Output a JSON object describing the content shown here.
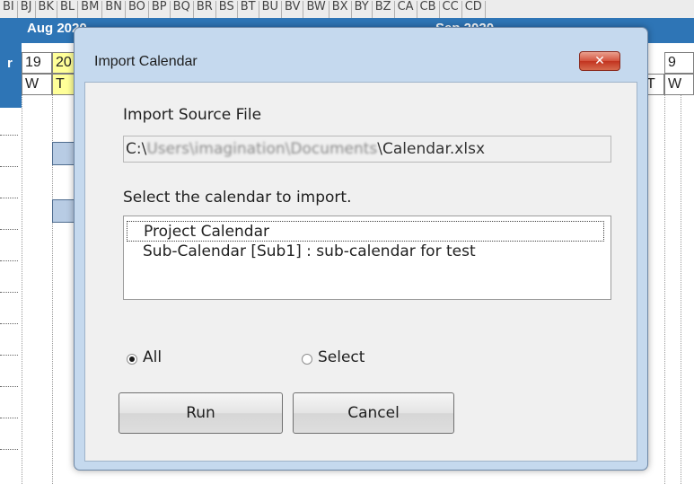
{
  "background": {
    "column_headers": [
      "BI",
      "BJ",
      "BK",
      "BL",
      "BM",
      "BN",
      "BO",
      "BP",
      "BQ",
      "BR",
      "BS",
      "BT",
      "BU",
      "BV",
      "BW",
      "BX",
      "BY",
      "BZ",
      "CA",
      "CB",
      "CC",
      "CD"
    ],
    "month_left": "Aug 2020",
    "month_right": "Sep 2020",
    "left_letter": "r",
    "day_cells": [
      {
        "text": "19",
        "yellow": false
      },
      {
        "text": "20",
        "yellow": true
      },
      {
        "text": "9",
        "yellow": false
      }
    ],
    "weekday_cells": [
      {
        "text": "W",
        "yellow": false
      },
      {
        "text": "T",
        "yellow": true
      },
      {
        "text": "T",
        "yellow": false
      },
      {
        "text": "W",
        "yellow": false
      }
    ]
  },
  "dialog": {
    "title": "Import Calendar",
    "close_glyph": "✕",
    "source_label": "Import Source File",
    "source_path_prefix": "C:\\",
    "source_path_blurred": "Users\\imagination\\Documents",
    "source_path_file": "\\Calendar.xlsx",
    "select_label": "Select the calendar to import.",
    "calendars": [
      {
        "label": "Project Calendar",
        "focused": true
      },
      {
        "label": "Sub-Calendar  [Sub1] : sub-calendar for test",
        "focused": false
      }
    ],
    "radio_all_label": "All",
    "radio_select_label": "Select",
    "radio_selected": "All",
    "run_label": "Run",
    "cancel_label": "Cancel"
  },
  "colors": {
    "header_blue": "#2e75b6",
    "today_yellow": "#ffff99",
    "dialog_frame": "#c5d9ee",
    "close_red": "#c2331f"
  }
}
